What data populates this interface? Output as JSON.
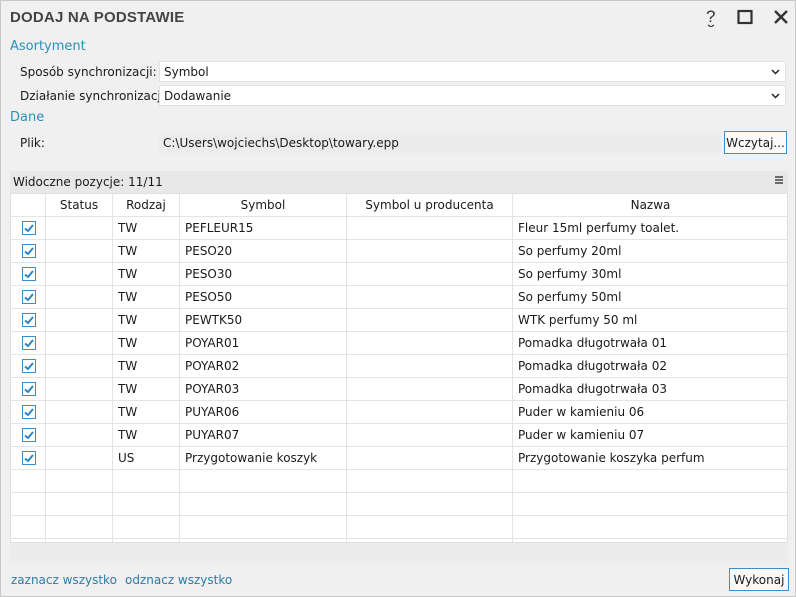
{
  "window": {
    "title": "DODAJ NA PODSTAWIE"
  },
  "assortment": {
    "heading": "Asortyment",
    "sync_method_label": "Sposób synchronizacji:",
    "sync_method_value": "Symbol",
    "sync_action_label": "Działanie synchronizacji:",
    "sync_action_value": "Dodawanie"
  },
  "data_section": {
    "heading": "Dane",
    "file_label": "Plik:",
    "file_path": "C:\\Users\\wojciechs\\Desktop\\towary.epp",
    "load_button": "Wczytaj..."
  },
  "grid": {
    "visible_label": "Widoczne pozycje: 11/11",
    "columns": [
      "",
      "Status",
      "Rodzaj",
      "Symbol",
      "Symbol u producenta",
      "Nazwa"
    ],
    "rows": [
      {
        "checked": true,
        "status": "",
        "type": "TW",
        "symbol": "PEFLEUR15",
        "producer_symbol": "",
        "name": "Fleur 15ml perfumy toalet."
      },
      {
        "checked": true,
        "status": "",
        "type": "TW",
        "symbol": "PESO20",
        "producer_symbol": "",
        "name": "So perfumy 20ml"
      },
      {
        "checked": true,
        "status": "",
        "type": "TW",
        "symbol": "PESO30",
        "producer_symbol": "",
        "name": "So perfumy 30ml"
      },
      {
        "checked": true,
        "status": "",
        "type": "TW",
        "symbol": "PESO50",
        "producer_symbol": "",
        "name": "So perfumy 50ml"
      },
      {
        "checked": true,
        "status": "",
        "type": "TW",
        "symbol": "PEWTK50",
        "producer_symbol": "",
        "name": "WTK perfumy 50 ml"
      },
      {
        "checked": true,
        "status": "",
        "type": "TW",
        "symbol": "POYAR01",
        "producer_symbol": "",
        "name": "Pomadka długotrwała 01"
      },
      {
        "checked": true,
        "status": "",
        "type": "TW",
        "symbol": "POYAR02",
        "producer_symbol": "",
        "name": "Pomadka długotrwała 02"
      },
      {
        "checked": true,
        "status": "",
        "type": "TW",
        "symbol": "POYAR03",
        "producer_symbol": "",
        "name": "Pomadka długotrwała 03"
      },
      {
        "checked": true,
        "status": "",
        "type": "TW",
        "symbol": "PUYAR06",
        "producer_symbol": "",
        "name": "Puder w kamieniu 06"
      },
      {
        "checked": true,
        "status": "",
        "type": "TW",
        "symbol": "PUYAR07",
        "producer_symbol": "",
        "name": "Puder w kamieniu 07"
      },
      {
        "checked": true,
        "status": "",
        "type": "US",
        "symbol": "Przygotowanie koszyk",
        "producer_symbol": "",
        "name": "Przygotowanie koszyka perfum"
      }
    ]
  },
  "footer": {
    "select_all": "zaznacz wszystko",
    "deselect_all": "odznacz wszystko",
    "execute_button": "Wykonaj"
  },
  "colors": {
    "accent": "#2a8fb8",
    "border_accent": "#3c8ec4",
    "check": "#2a86c0"
  }
}
